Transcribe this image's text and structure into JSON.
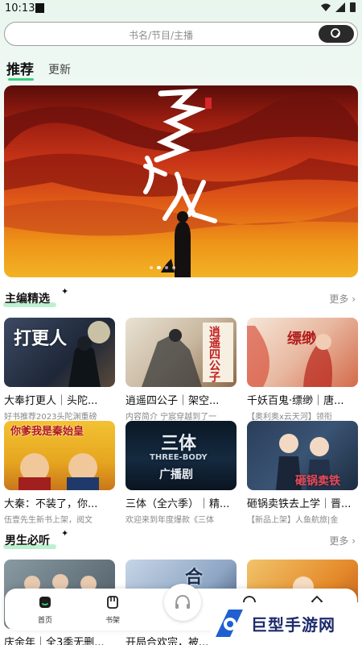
{
  "status": {
    "time": "10:13"
  },
  "search": {
    "placeholder": "书名/节目/主播"
  },
  "tabs": [
    {
      "label": "推荐",
      "active": true
    },
    {
      "label": "更新",
      "active": false
    }
  ],
  "banner": {
    "title_art": "天命除妖人",
    "slide_count": 4,
    "active_slide": 2
  },
  "sections": [
    {
      "title": "主编精选",
      "more_label": "更多",
      "items": [
        {
          "title": "大奉打更人｜头陀...",
          "subtitle": "好书推荐2023头陀渊重磅",
          "cover_text": "打更人"
        },
        {
          "title": "逍遥四公子｜架空...",
          "subtitle": "内容简介 宁宸穿越到了一",
          "cover_text": "逍遥四公子"
        },
        {
          "title": "千妖百鬼·缥缈｜唐...",
          "subtitle": "【奥利奥x云天河】领衔",
          "cover_text": "缥缈"
        },
        {
          "title": "大秦：不装了，你...",
          "subtitle": "伍壹先生新书上架，阅文",
          "cover_text": "你爹我是秦始皇"
        },
        {
          "title": "三体（全六季）｜精...",
          "subtitle": "欢迎来到年度爆款《三体",
          "cover_text": "三体"
        },
        {
          "title": "砸锅卖铁去上学｜晋...",
          "subtitle": "【新品上架】人鱼航旅|金",
          "cover_text": "砸锅卖铁"
        }
      ]
    },
    {
      "title": "男生必听",
      "more_label": "更多",
      "items": [
        {
          "title": "庆余年｜全3季无删...",
          "subtitle": "",
          "cover_text": ""
        },
        {
          "title": "开局合欢宗，被...",
          "subtitle": "",
          "cover_text": "合"
        },
        {
          "title": "",
          "subtitle": "",
          "cover_text": ""
        }
      ]
    }
  ],
  "three_body_sub": "THREE-BODY",
  "three_body_tag": "广播剧",
  "bottom_nav": [
    {
      "label": "首页",
      "icon": "home-icon"
    },
    {
      "label": "书架",
      "icon": "bookshelf-icon"
    },
    {
      "label": "",
      "icon": "headphones-icon"
    },
    {
      "label": "",
      "icon": "discover-icon"
    },
    {
      "label": "",
      "icon": "profile-icon"
    }
  ],
  "watermark": {
    "text": "巨型手游网"
  },
  "colors": {
    "accent": "#38d27a",
    "banner_red": "#c83518",
    "banner_orange": "#ee9418"
  }
}
